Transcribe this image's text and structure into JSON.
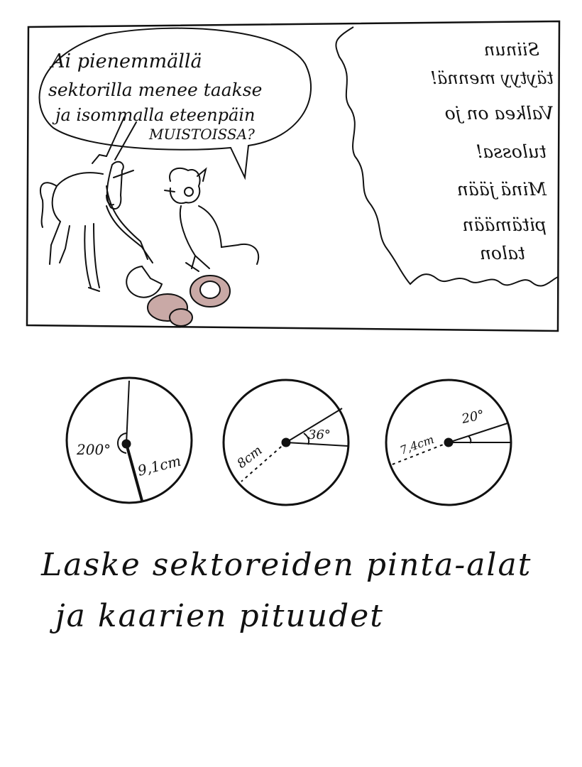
{
  "speech_bubble": {
    "line1": "Ai pienemmällä",
    "line2": "sektorilla menee taakse",
    "line3": "ja isommalla eteenpäin",
    "line4": "MUISTOISSA?"
  },
  "mirror_bubble": {
    "lines": [
      "Siinun",
      "täytyy mennä!",
      "Valkea on jo",
      "tulossa!",
      "Minä jään",
      "pitämään",
      "talon"
    ]
  },
  "sectors": [
    {
      "angle_label": "200°",
      "radius_label": "9,1cm"
    },
    {
      "angle_label": "36°",
      "radius_label": "8cm"
    },
    {
      "angle_label": "20°",
      "radius_label": "7,4cm"
    }
  ],
  "task": {
    "line1": "Laske sektoreiden  pinta-alat",
    "line2": "ja  kaarien  pituudet"
  },
  "colors": {
    "mushroom": "#c9a9a6",
    "ink": "#111111"
  }
}
